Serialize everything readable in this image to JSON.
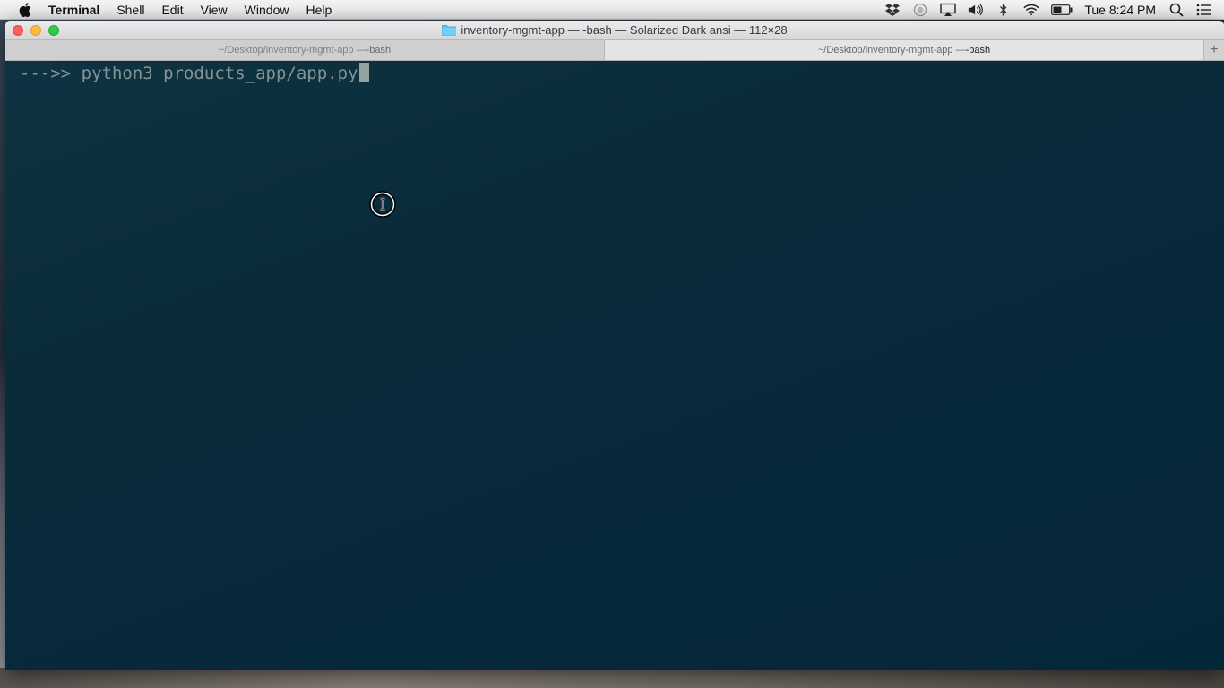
{
  "menubar": {
    "app_name": "Terminal",
    "items": [
      "Shell",
      "Edit",
      "View",
      "Window",
      "Help"
    ],
    "status_icons": [
      "dropbox-icon",
      "record-icon",
      "airplay-icon",
      "volume-icon",
      "bluetooth-icon",
      "wifi-icon",
      "battery-icon"
    ],
    "clock": "Tue 8:24 PM"
  },
  "window": {
    "title": "inventory-mgmt-app — -bash — Solarized Dark ansi — 112×28",
    "tabs": [
      {
        "path": "~/Desktop/inventory-mgmt-app — ",
        "process": "-bash",
        "active": false
      },
      {
        "path": "~/Desktop/inventory-mgmt-app — ",
        "process": "-bash",
        "active": true
      }
    ],
    "new_tab_label": "+"
  },
  "terminal": {
    "prompt": "--->> ",
    "command": "python3 products_app/app.py",
    "theme": "Solarized Dark ansi",
    "background": "#072b3a",
    "foreground": "#839496"
  }
}
